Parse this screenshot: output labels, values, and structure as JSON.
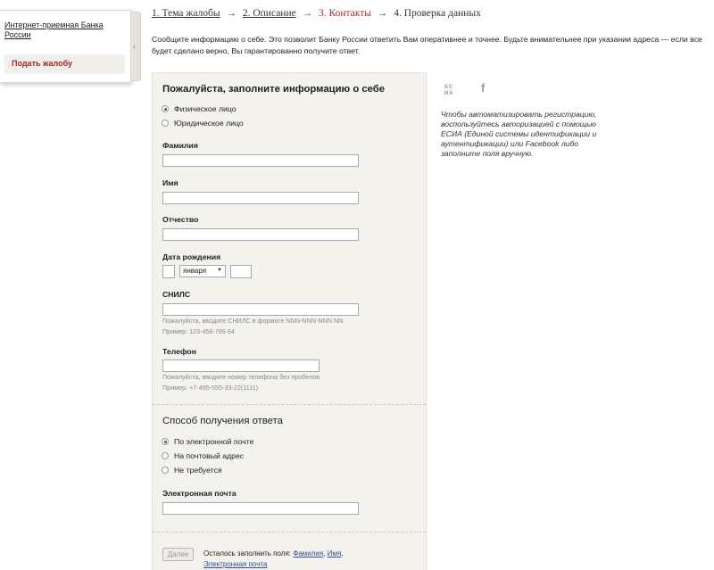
{
  "sidebar": {
    "title": "Интернет-приемная Банка России",
    "item": "Подать жалобу",
    "collapse_glyph": "‹"
  },
  "steps": {
    "step1": "1. Тема жалобы",
    "step2": "2. Описание",
    "step3": "3. Контакты",
    "step4": "4. Проверка данных",
    "arrow": "→"
  },
  "intro": "Сообщите информацию о себе. Это позволит Банку России ответить Вам оперативнее и точнее. Будьте внимательнее при указании адреса — если все будет сделано верно, Вы гарантированно получите ответ.",
  "form": {
    "heading": "Пожалуйста, заполните информацию о себе",
    "person_type": [
      "Физическое лицо",
      "Юридическое лицо"
    ],
    "surname_label": "Фамилия",
    "name_label": "Имя",
    "patronymic_label": "Отчество",
    "birthdate_label": "Дата рождения",
    "birth_month": "января",
    "snils_label": "СНИЛС",
    "snils_hint": "Пожалуйста, вводите СНИЛС в формате NNN-NNN-NNN NN",
    "snils_example": "Пример: 123-456-789 64",
    "phone_label": "Телефон",
    "phone_hint": "Пожалуйста, вводите номер телефона без пробелов",
    "phone_example": "Пример: +7-495-555-33-22(1111)",
    "reply_heading": "Способ получения ответа",
    "reply_options": [
      "По электронной почте",
      "На почтовый адрес",
      "Не требуется"
    ],
    "email_label": "Электронная почта",
    "next_button": "Далее",
    "remaining_prefix": "Осталось заполнить поля:",
    "remaining_fields": [
      "Фамилия",
      "Имя",
      "Электронная почта"
    ],
    "remaining_sep": ","
  },
  "auth": {
    "esia_icon_text": "ЕС ИА",
    "fb_icon_text": "f",
    "note": "Чтобы автоматизировать регистрацию, воспользуйтесь авторизацией с помощью ЕСИА (Единой системы идентификации и аутентификации) или Facebook либо заполните поля вручную."
  }
}
